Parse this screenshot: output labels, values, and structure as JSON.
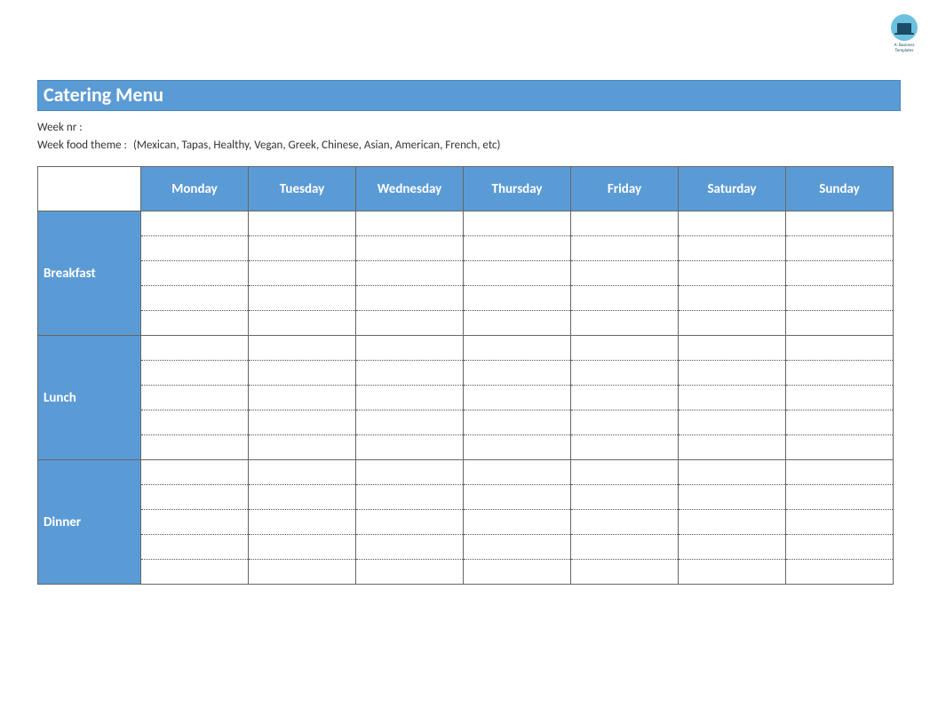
{
  "logo": {
    "line1": "A: Business",
    "line2": "Templates"
  },
  "title": "Catering Menu",
  "meta": {
    "week_nr_label": "Week nr :",
    "week_nr_value": "",
    "theme_label": "Week food theme :",
    "theme_value": "(Mexican, Tapas, Healthy, Vegan, Greek, Chinese, Asian, American, French, etc)"
  },
  "days": [
    "Monday",
    "Tuesday",
    "Wednesday",
    "Thursday",
    "Friday",
    "Saturday",
    "Sunday"
  ],
  "meals": [
    "Breakfast",
    "Lunch",
    "Dinner"
  ],
  "lines_per_cell": 5
}
